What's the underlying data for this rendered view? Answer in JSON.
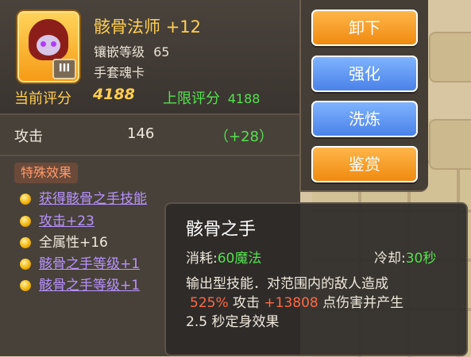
{
  "item": {
    "name": "骸骨法师",
    "enhance": "+12",
    "inlay_label": "镶嵌等级",
    "inlay_value": "65",
    "category": "手套魂卡",
    "rank_badge": "III",
    "current_score_label": "当前评分",
    "current_score_value": "4188",
    "max_score_label": "上限评分",
    "max_score_value": "4188"
  },
  "stats": {
    "label": "攻击",
    "value": "146",
    "bonus": "（+28）"
  },
  "special": {
    "title": "特殊效果",
    "effects": [
      {
        "text": "获得骸骨之手技能",
        "color": "purple"
      },
      {
        "text": "攻击+23",
        "color": "purple"
      },
      {
        "text": "全属性+16",
        "color": "white"
      },
      {
        "text": "骸骨之手等级+1",
        "color": "purple"
      },
      {
        "text": "骸骨之手等级+1",
        "color": "purple"
      }
    ]
  },
  "actions": {
    "unequip": "卸下",
    "strengthen": "强化",
    "refine": "洗炼",
    "appraise": "鉴赏"
  },
  "tooltip": {
    "title": "骸骨之手",
    "cost_label": "消耗:",
    "cost_value": "60魔法",
    "cooldown_label": "冷却:",
    "cooldown_value": "30秒",
    "desc_line1": "输出型技能．对范围内的敌人造成",
    "desc_pct": "525%",
    "desc_attack": "攻击",
    "desc_bonus": "+13808",
    "desc_tail": "点伤害并产生",
    "desc_line3": "2.5 秒定身效果"
  },
  "colors": {
    "gold": "#ffcf52",
    "green": "#55e050",
    "purple": "#b892ff",
    "orange_button": "#f08a10",
    "blue_button": "#4a82e8"
  }
}
